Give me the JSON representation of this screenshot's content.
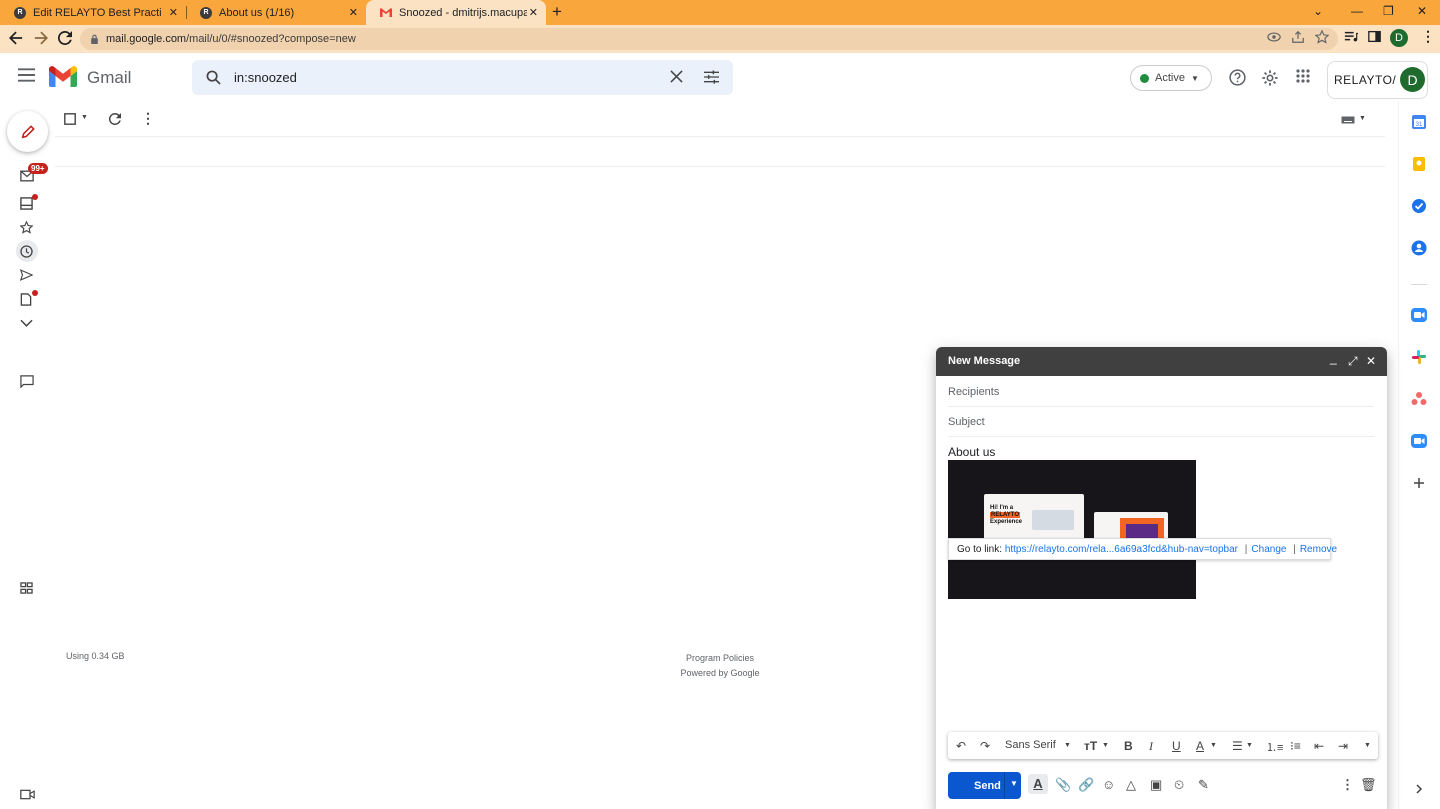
{
  "browser": {
    "tabs": [
      {
        "title": "Edit RELAYTO Best Practices for S",
        "active": false
      },
      {
        "title": "About us (1/16)",
        "active": false
      },
      {
        "title": "Snoozed - dmitrijs.macupa@rela",
        "active": true
      }
    ],
    "url_domain": "mail.google.com",
    "url_path": "/mail/u/0/#snoozed?compose=new",
    "profile_initial": "D",
    "tab_bar_color": "#f9a63d"
  },
  "gmail": {
    "app_name": "Gmail",
    "search_value": "in:snoozed",
    "status_label": "Active",
    "account_brand": "RELAYTO/",
    "account_initial": "D",
    "unread_badge": "99+",
    "storage_text": "Using 0.34 GB",
    "footer_line1": "Program Policies",
    "footer_line2": "Powered by Google"
  },
  "compose": {
    "title": "New Message",
    "recipients_placeholder": "Recipients",
    "subject_placeholder": "Subject",
    "body_text": "About us",
    "image_text_line1": "Hi! I'm a",
    "image_text_line2": "RELAYTO",
    "image_text_line3": "Experience",
    "link_prefix": "Go to link:",
    "link_url": "https://relayto.com/rela...6a69a3fcd&hub-nav=topbar",
    "link_change": "Change",
    "link_remove": "Remove",
    "font_name": "Sans Serif",
    "send_label": "Send",
    "accent_color": "#0b57d0"
  }
}
